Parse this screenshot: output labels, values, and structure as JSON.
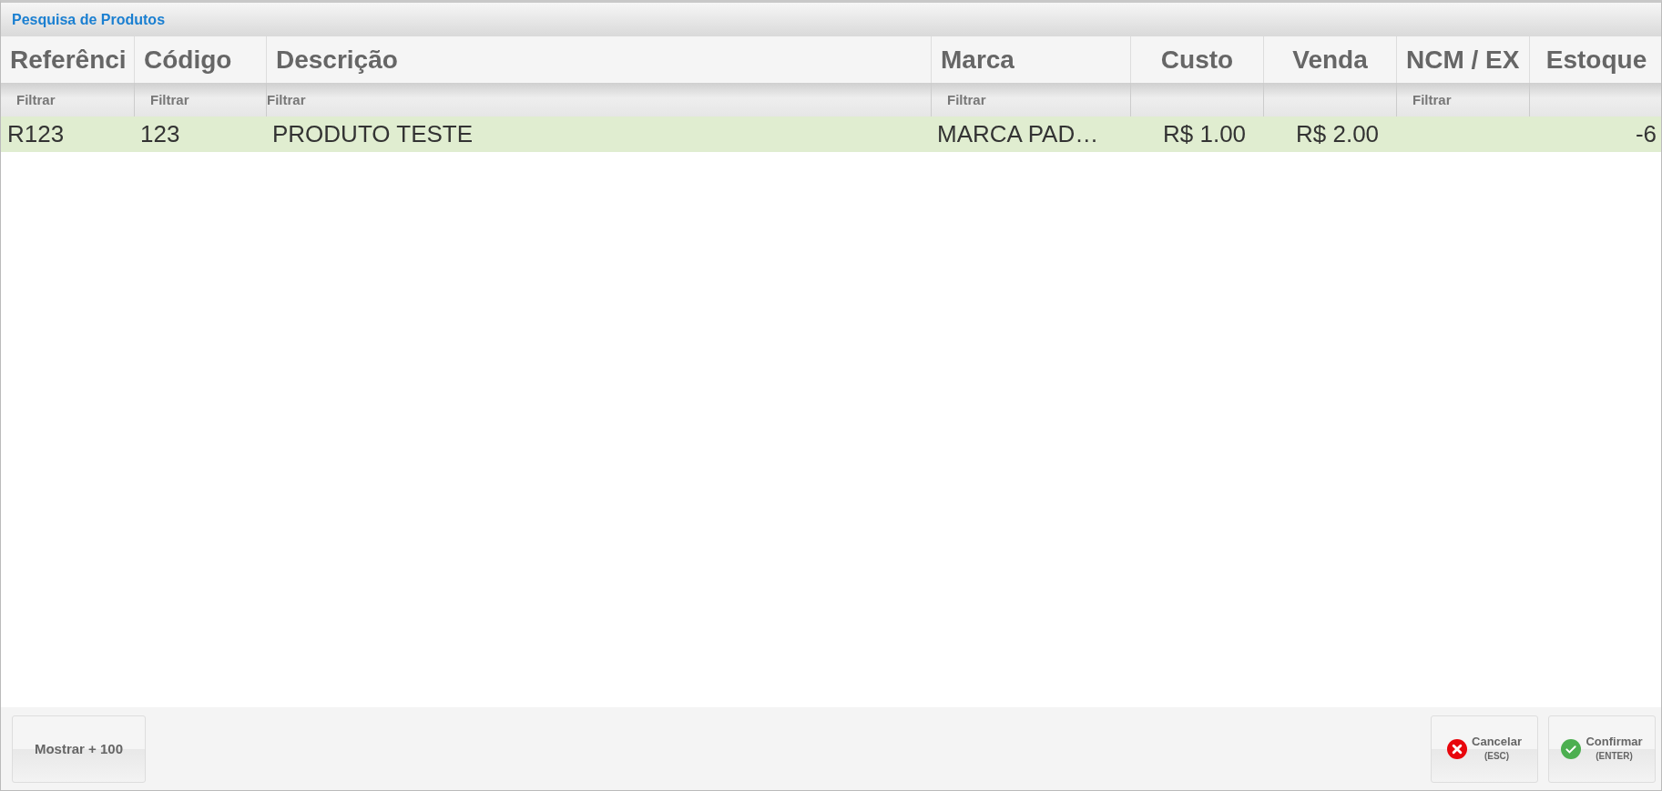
{
  "window": {
    "title": "Pesquisa de Produtos"
  },
  "table": {
    "columns": [
      {
        "label": "Referênci",
        "filter": {
          "placeholder": "Filtrar"
        }
      },
      {
        "label": "Código",
        "filter": {
          "placeholder": "Filtrar"
        }
      },
      {
        "label": "Descrição",
        "filter": {
          "placeholder": "Filtrar"
        }
      },
      {
        "label": "Marca",
        "filter": {
          "placeholder": "Filtrar"
        }
      },
      {
        "label": "Custo"
      },
      {
        "label": "Venda"
      },
      {
        "label": "NCM / EX",
        "filter": {
          "placeholder": "Filtrar"
        }
      },
      {
        "label": "Estoque"
      }
    ],
    "rows": [
      {
        "selected": true,
        "cells": [
          "R123",
          "123",
          "PRODUTO TESTE",
          "MARCA PAD…",
          "R$ 1.00",
          "R$ 2.00",
          "",
          "-6"
        ]
      }
    ]
  },
  "buttons": [
    {
      "kind": "plain",
      "label": "Mostrar + 100"
    },
    {
      "kind": "cancel",
      "label": "Cancelar",
      "shortcut": "(ESC)"
    },
    {
      "kind": "confirm",
      "label": "Confirmar",
      "shortcut": "(ENTER)"
    }
  ]
}
